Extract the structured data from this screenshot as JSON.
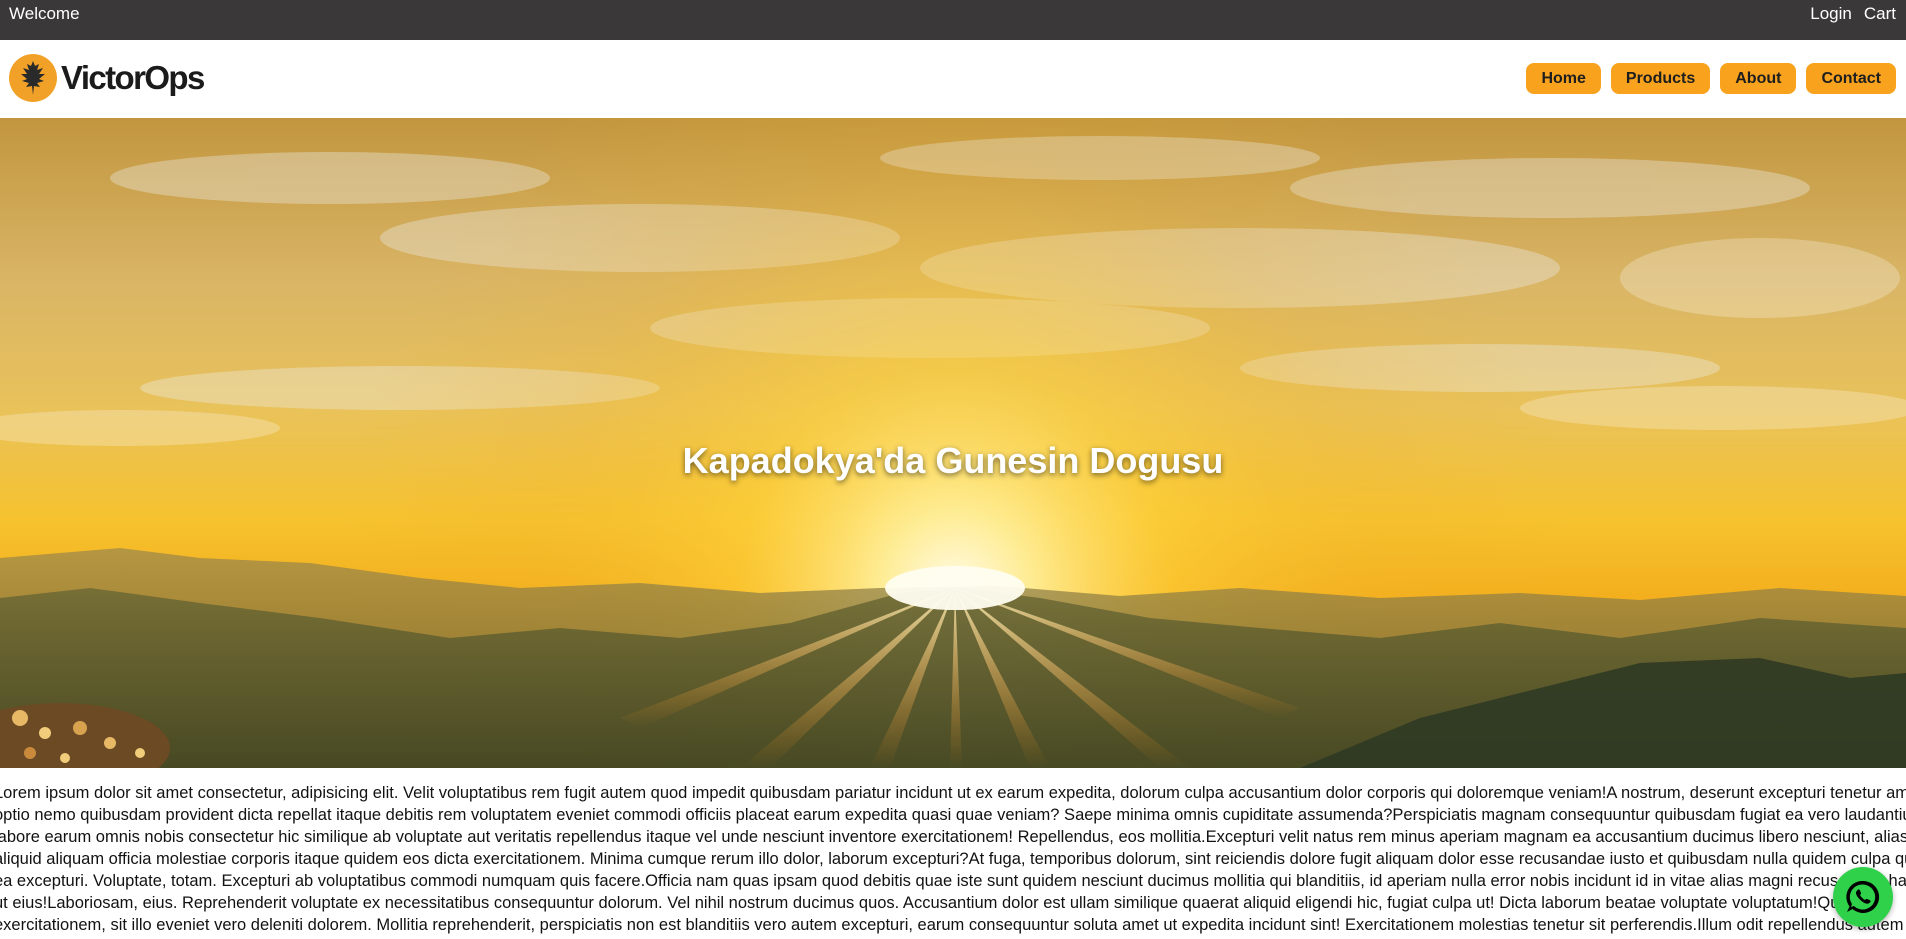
{
  "topbar": {
    "welcome": "Welcome",
    "login": "Login",
    "cart": "Cart"
  },
  "logo": {
    "text": "VictorOps",
    "icon": "leaf-icon",
    "color": "#f2a128"
  },
  "nav": {
    "items": [
      "Home",
      "Products",
      "About",
      "Contact"
    ],
    "accent": "#f8a21d"
  },
  "hero": {
    "title": "Kapadokya'da Gunesin Dogusu",
    "image": "sunrise-over-mountains"
  },
  "content": {
    "lines": [
      "Lorem ipsum dolor sit amet consectetur, adipisicing elit. Velit voluptatibus rem fugit autem quod impedit quibusdam pariatur incidunt ut ex earum expedita, dolorum culpa accusantium dolor corporis qui doloremque veniam!A nostrum, deserunt excepturi tenetur amet",
      "optio nemo quibusdam provident dicta repellat itaque debitis rem voluptatem eveniet commodi officiis placeat earum expedita quasi quae veniam? Saepe minima omnis cupiditate assumenda?Perspiciatis magnam consequuntur quibusdam fugiat ea vero laudantium ad,",
      "labore earum omnis nobis consectetur hic similique ab voluptate aut veritatis repellendus itaque vel unde nesciunt inventore exercitationem! Repellendus, eos mollitia.Excepturi velit natus rem minus aperiam magnam ea accusantium ducimus libero nesciunt, alias",
      "aliquid aliquam officia molestiae corporis itaque quidem eos dicta exercitationem. Minima cumque rerum illo dolor, laborum excepturi?At fuga, temporibus dolorum, sint reiciendis dolore fugit aliquam dolor esse recusandae iusto et quibusdam nulla quidem culpa quam,",
      "ea excepturi. Voluptate, totam. Excepturi ab voluptatibus commodi numquam quis facere.Officia nam quas ipsam quod debitis quae iste sunt quidem nesciunt ducimus mollitia qui blanditiis, id aperiam nulla error nobis incidunt id in vitae alias magni recusandae harum,",
      "ut eius!Laboriosam, eius. Reprehenderit voluptate ex necessitatibus consequuntur dolorum. Vel nihil nostrum ducimus quos. Accusantium dolor est ullam similique quaerat aliquid eligendi hic, fugiat culpa ut! Dicta laborum beatae voluptate voluptatum!Quasi",
      "exercitationem, sit illo eveniet vero deleniti dolorem. Mollitia reprehenderit, perspiciatis non est blanditiis vero autem excepturi, earum consequuntur soluta amet ut expedita incidunt sint! Exercitationem molestias tenetur sit perferendis.Illum odit repellendus autem"
    ]
  },
  "whatsapp": {
    "icon": "whatsapp-icon",
    "color": "#2fd14a"
  }
}
